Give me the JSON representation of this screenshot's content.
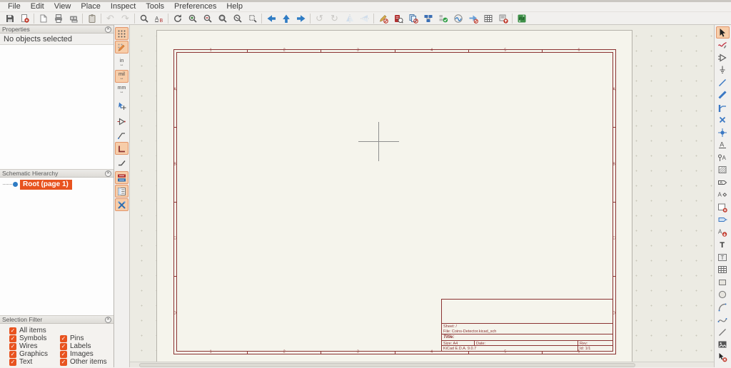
{
  "menubar": {
    "items": [
      "File",
      "Edit",
      "View",
      "Place",
      "Inspect",
      "Tools",
      "Preferences",
      "Help"
    ]
  },
  "top_toolbar": {
    "icons": [
      "save",
      "schematic-setup",
      "page-settings",
      "print",
      "plot",
      "paste",
      "undo",
      "redo",
      "find",
      "find-replace",
      "refresh-view",
      "zoom-in",
      "zoom-out",
      "zoom-fit-page",
      "zoom-fit-objects",
      "zoom-selection",
      "navigate-back",
      "navigate-up",
      "navigate-forward",
      "rotate-ccw",
      "rotate-cw",
      "mirror-vertical",
      "mirror-horizontal",
      "annotate",
      "run-erc",
      "symbol-library-links",
      "bus-definitions",
      "annotation-check",
      "simulator",
      "update-pcb",
      "symbol-fields-table",
      "generate-bom",
      "open-pcb-editor"
    ]
  },
  "properties_panel": {
    "title": "Properties",
    "empty_message": "No objects selected"
  },
  "hierarchy_panel": {
    "title": "Schematic Hierarchy",
    "root_item": "Root (page 1)"
  },
  "selection_filter": {
    "title": "Selection Filter",
    "items": [
      "All items",
      "Symbols",
      "Pins",
      "Wires",
      "Labels",
      "Graphics",
      "Images",
      "Text",
      "Other items"
    ]
  },
  "left_toolbar": {
    "icons": [
      "show-grid",
      "grid-overrides",
      "units-inches",
      "units-mils",
      "units-mm",
      "crosshair-style",
      "show-hidden-pins",
      "line-mode-free",
      "line-mode-90",
      "line-mode-45",
      "annotate-automatically",
      "hierarchy-navigator",
      "properties-manager"
    ],
    "units": {
      "in": "in",
      "mil": "mil",
      "mm": "mm"
    }
  },
  "right_toolbar": {
    "icons": [
      "select-tool",
      "highlight-net",
      "place-symbol",
      "place-power-symbol",
      "draw-wire",
      "draw-bus",
      "wire-to-bus-entry",
      "no-connect-flag",
      "place-junction",
      "net-label",
      "netclass-directive",
      "rule-area",
      "global-label",
      "hierarchical-label",
      "hierarchical-sheet",
      "sheet-pin",
      "import-sheet-pin",
      "place-text",
      "text-box",
      "place-table",
      "draw-rectangle",
      "draw-circle",
      "draw-arc",
      "draw-bezier",
      "draw-line",
      "place-image",
      "delete-tool"
    ]
  },
  "canvas": {
    "frame": {
      "columns": [
        "1",
        "2",
        "3",
        "4",
        "5",
        "6"
      ],
      "rows": [
        "A",
        "B",
        "C",
        "D"
      ]
    },
    "title_block": {
      "sheet": "Sheet: /",
      "file": "File: Coins-Detector.kicad_sch",
      "title": "Title:",
      "size": "Size: A4",
      "date": "Date:",
      "rev": "Rev:",
      "generator": "KiCad E.D.A. 9.0.7",
      "id": "Id: 1/1"
    }
  },
  "colors": {
    "accent_orange": "#e8531f",
    "frame_red": "#8b3332",
    "wire_blue": "#3b78c3",
    "active_tool_bg": "#f7cda9",
    "canvas_bg": "#ecebe3",
    "page_bg": "#f5f4ec"
  }
}
